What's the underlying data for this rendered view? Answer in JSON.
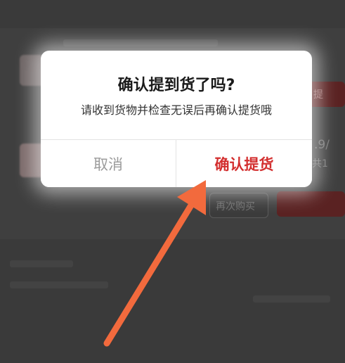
{
  "colors": {
    "confirm_text": "#d32f2f",
    "cancel_text": "#9b9b9b",
    "annotation_arrow": "#f26a3d",
    "overlay": "#2f2f2f"
  },
  "dialog": {
    "title": "确认提到货了吗?",
    "message": "请收到货物并检查无误后再确认提货哦",
    "cancel_label": "取消",
    "confirm_label": "确认提货"
  },
  "background": {
    "price_fragment": ".9/",
    "count_fragment": "共1",
    "red_button_fragment": "提",
    "grey_button_fragment": "再次购买"
  },
  "annotation": {
    "icon": "arrow-pointing-up-right"
  }
}
